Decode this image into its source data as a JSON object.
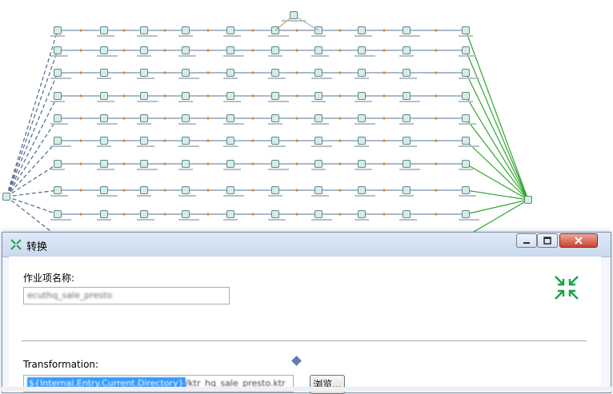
{
  "dialog": {
    "title": "转换",
    "job_name_label": "作业项名称:",
    "job_name_value": "ecuthq_sale_presto",
    "transformation_label": "Transformation:",
    "transformation_value_prefix": "${Internal.Entry.Current.Directory}",
    "transformation_value_suffix": "/ktr_hq_sale_presto.ktr",
    "browse_label": "浏览..."
  },
  "colors": {
    "flow_line": "#8fa3b8",
    "join_dashed": "#5b7290",
    "success_line": "#2fa52f",
    "node_fill": "#d6ece6",
    "node_border": "#5f8a84",
    "selection": "#3399ff"
  },
  "icons": [
    "transform-dialog-icon",
    "minimize-icon",
    "maximize-icon",
    "close-icon",
    "collapse-arrows-icon",
    "variable-diamond-icon"
  ]
}
